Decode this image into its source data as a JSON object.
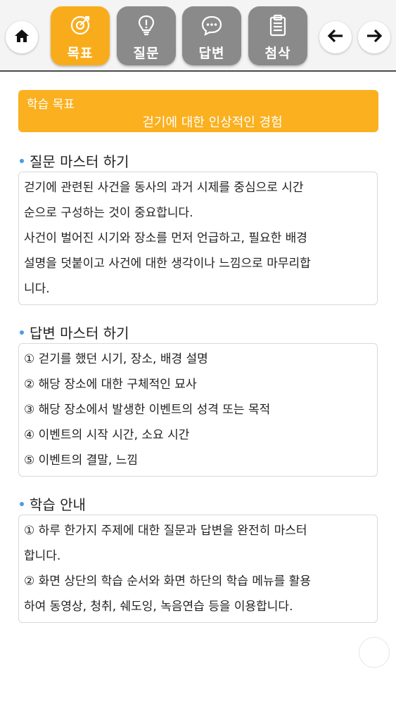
{
  "nav": {
    "home_icon": "home-icon",
    "tabs": [
      {
        "label": "목표",
        "icon": "target-icon",
        "active": true
      },
      {
        "label": "질문",
        "icon": "lightbulb-icon",
        "active": false
      },
      {
        "label": "답변",
        "icon": "speech-bubble-icon",
        "active": false
      },
      {
        "label": "첨삭",
        "icon": "clipboard-icon",
        "active": false
      }
    ],
    "back_icon": "arrow-left-icon",
    "forward_icon": "arrow-right-icon",
    "active_color": "#f9ac1b",
    "inactive_color": "#8a8a8a"
  },
  "goal": {
    "label": "학습 목표",
    "title": "걷기에 대한 인상적인 경험",
    "color": "#fbb01f"
  },
  "question_master": {
    "title": "질문 마스터 하기",
    "lines": [
      "걷기에 관련된 사건을 동사의 과거 시제를 중심으로 시간",
      "순으로 구성하는 것이 중요합니다.",
      "사건이 벌어진 시기와 장소를 먼저 언급하고, 필요한 배경",
      "설명을 덧붙이고 사건에 대한 생각이나 느낌으로 마무리합",
      "니다."
    ]
  },
  "answer_master": {
    "title": "답변 마스터 하기",
    "lines": [
      "① 걷기를 했던 시기, 장소, 배경 설명",
      "② 해당 장소에 대한 구체적인 묘사",
      "③ 해당 장소에서 발생한 이벤트의 성격 또는 목적",
      "④ 이벤트의 시작 시간, 소요 시간",
      "⑤ 이벤트의 결말, 느낌"
    ]
  },
  "study_guide": {
    "title": "학습 안내",
    "lines": [
      "① 하루 한가지 주제에 대한 질문과 답변을 완전히 마스터",
      "합니다.",
      "② 화면 상단의 학습 순서와 화면 하단의 학습 메뉴를 활용",
      "하여 동영상, 청취, 쉐도잉, 녹음연습 등을 이용합니다."
    ]
  },
  "bullet_color": "#4a9be6"
}
